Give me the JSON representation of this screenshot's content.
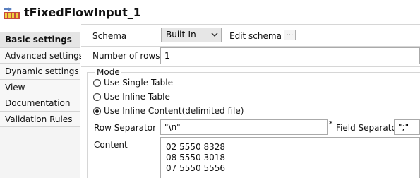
{
  "component": {
    "title": "tFixedFlowInput_1",
    "icon": "fixed-flow-input-icon"
  },
  "sidebar": {
    "items": [
      {
        "label": "Basic settings",
        "active": true
      },
      {
        "label": "Advanced settings",
        "active": false
      },
      {
        "label": "Dynamic settings",
        "active": false
      },
      {
        "label": "View",
        "active": false
      },
      {
        "label": "Documentation",
        "active": false
      },
      {
        "label": "Validation Rules",
        "active": false
      }
    ]
  },
  "settings": {
    "schema_label": "Schema",
    "schema_value": "Built-In",
    "edit_schema_label": "Edit schema",
    "edit_schema_button": "...",
    "num_rows_label": "Number of rows",
    "num_rows_value": "1",
    "mode_label": "Mode",
    "modes": [
      {
        "label": "Use Single Table",
        "checked": false
      },
      {
        "label": "Use Inline Table",
        "checked": false
      },
      {
        "label": "Use Inline Content(delimited file)",
        "checked": true
      }
    ],
    "row_separator_label": "Row Separator",
    "row_separator_value": "\"\\n\"",
    "required_marker": "*",
    "field_separator_label": "Field Separator",
    "field_separator_value": "\";\"",
    "content_label": "Content",
    "content_lines": [
      "02 5550 8328",
      "08 5550 3018",
      "07 5550 5556"
    ]
  }
}
